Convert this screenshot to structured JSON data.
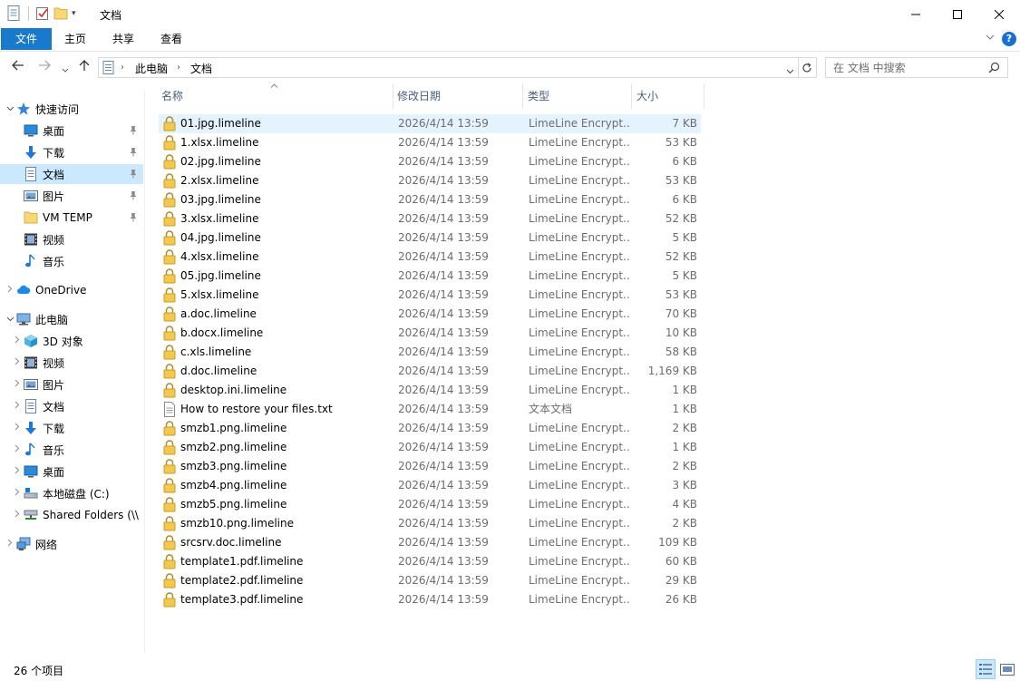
{
  "window": {
    "title": "文档"
  },
  "ribbon": {
    "tabs": [
      "文件",
      "主页",
      "共享",
      "查看"
    ],
    "help": "?"
  },
  "address": {
    "crumbs": [
      "此电脑",
      "文档"
    ],
    "search_placeholder": "在 文档 中搜索"
  },
  "nav": {
    "items": [
      {
        "label": "快速访问",
        "icon": "star-icon",
        "chev": "v",
        "indent": 0,
        "pinned": false,
        "selected": false
      },
      {
        "label": "桌面",
        "icon": "desktop-icon",
        "chev": "",
        "indent": 1,
        "pinned": true,
        "selected": false
      },
      {
        "label": "下载",
        "icon": "download-icon",
        "chev": "",
        "indent": 1,
        "pinned": true,
        "selected": false
      },
      {
        "label": "文档",
        "icon": "document-icon",
        "chev": "",
        "indent": 1,
        "pinned": true,
        "selected": true
      },
      {
        "label": "图片",
        "icon": "picture-icon",
        "chev": "",
        "indent": 1,
        "pinned": true,
        "selected": false
      },
      {
        "label": "VM TEMP",
        "icon": "folder-icon",
        "chev": "",
        "indent": 1,
        "pinned": true,
        "selected": false
      },
      {
        "label": "视频",
        "icon": "video-icon",
        "chev": "",
        "indent": 1,
        "pinned": false,
        "selected": false
      },
      {
        "label": "音乐",
        "icon": "music-icon",
        "chev": "",
        "indent": 1,
        "pinned": false,
        "selected": false
      },
      {
        "label": "OneDrive",
        "icon": "cloud-icon",
        "chev": ">",
        "indent": 0,
        "pinned": false,
        "selected": false
      },
      {
        "label": "此电脑",
        "icon": "computer-icon",
        "chev": "v",
        "indent": 0,
        "pinned": false,
        "selected": false
      },
      {
        "label": "3D 对象",
        "icon": "cube-icon",
        "chev": ">",
        "indent": 1,
        "pinned": false,
        "selected": false
      },
      {
        "label": "视频",
        "icon": "video-icon",
        "chev": ">",
        "indent": 1,
        "pinned": false,
        "selected": false
      },
      {
        "label": "图片",
        "icon": "picture-icon",
        "chev": ">",
        "indent": 1,
        "pinned": false,
        "selected": false
      },
      {
        "label": "文档",
        "icon": "document-icon",
        "chev": ">",
        "indent": 1,
        "pinned": false,
        "selected": false
      },
      {
        "label": "下载",
        "icon": "download-icon",
        "chev": ">",
        "indent": 1,
        "pinned": false,
        "selected": false
      },
      {
        "label": "音乐",
        "icon": "music-icon",
        "chev": ">",
        "indent": 1,
        "pinned": false,
        "selected": false
      },
      {
        "label": "桌面",
        "icon": "desktop-icon",
        "chev": ">",
        "indent": 1,
        "pinned": false,
        "selected": false
      },
      {
        "label": "本地磁盘 (C:)",
        "icon": "drive-icon",
        "chev": ">",
        "indent": 1,
        "pinned": false,
        "selected": false
      },
      {
        "label": "Shared Folders (\\\\",
        "icon": "network-drive-icon",
        "chev": ">",
        "indent": 1,
        "pinned": false,
        "selected": false
      },
      {
        "label": "网络",
        "icon": "network-icon",
        "chev": ">",
        "indent": 0,
        "pinned": false,
        "selected": false
      }
    ]
  },
  "columns": {
    "name": "名称",
    "date": "修改日期",
    "type": "类型",
    "size": "大小"
  },
  "files": [
    {
      "name": "01.jpg.limeline",
      "date": "2026/4/14 13:59",
      "type": "LimeLine Encrypt...",
      "size": "7 KB",
      "icon": "lock-icon",
      "selected": true
    },
    {
      "name": "1.xlsx.limeline",
      "date": "2026/4/14 13:59",
      "type": "LimeLine Encrypt...",
      "size": "53 KB",
      "icon": "lock-icon"
    },
    {
      "name": "02.jpg.limeline",
      "date": "2026/4/14 13:59",
      "type": "LimeLine Encrypt...",
      "size": "6 KB",
      "icon": "lock-icon"
    },
    {
      "name": "2.xlsx.limeline",
      "date": "2026/4/14 13:59",
      "type": "LimeLine Encrypt...",
      "size": "53 KB",
      "icon": "lock-icon"
    },
    {
      "name": "03.jpg.limeline",
      "date": "2026/4/14 13:59",
      "type": "LimeLine Encrypt...",
      "size": "6 KB",
      "icon": "lock-icon"
    },
    {
      "name": "3.xlsx.limeline",
      "date": "2026/4/14 13:59",
      "type": "LimeLine Encrypt...",
      "size": "52 KB",
      "icon": "lock-icon"
    },
    {
      "name": "04.jpg.limeline",
      "date": "2026/4/14 13:59",
      "type": "LimeLine Encrypt...",
      "size": "5 KB",
      "icon": "lock-icon"
    },
    {
      "name": "4.xlsx.limeline",
      "date": "2026/4/14 13:59",
      "type": "LimeLine Encrypt...",
      "size": "52 KB",
      "icon": "lock-icon"
    },
    {
      "name": "05.jpg.limeline",
      "date": "2026/4/14 13:59",
      "type": "LimeLine Encrypt...",
      "size": "5 KB",
      "icon": "lock-icon"
    },
    {
      "name": "5.xlsx.limeline",
      "date": "2026/4/14 13:59",
      "type": "LimeLine Encrypt...",
      "size": "53 KB",
      "icon": "lock-icon"
    },
    {
      "name": "a.doc.limeline",
      "date": "2026/4/14 13:59",
      "type": "LimeLine Encrypt...",
      "size": "70 KB",
      "icon": "lock-icon"
    },
    {
      "name": "b.docx.limeline",
      "date": "2026/4/14 13:59",
      "type": "LimeLine Encrypt...",
      "size": "10 KB",
      "icon": "lock-icon"
    },
    {
      "name": "c.xls.limeline",
      "date": "2026/4/14 13:59",
      "type": "LimeLine Encrypt...",
      "size": "58 KB",
      "icon": "lock-icon"
    },
    {
      "name": "d.doc.limeline",
      "date": "2026/4/14 13:59",
      "type": "LimeLine Encrypt...",
      "size": "1,169 KB",
      "icon": "lock-icon"
    },
    {
      "name": "desktop.ini.limeline",
      "date": "2026/4/14 13:59",
      "type": "LimeLine Encrypt...",
      "size": "1 KB",
      "icon": "lock-icon"
    },
    {
      "name": "How to restore your files.txt",
      "date": "2026/4/14 13:59",
      "type": "文本文档",
      "size": "1 KB",
      "icon": "text-file-icon"
    },
    {
      "name": "smzb1.png.limeline",
      "date": "2026/4/14 13:59",
      "type": "LimeLine Encrypt...",
      "size": "2 KB",
      "icon": "lock-icon"
    },
    {
      "name": "smzb2.png.limeline",
      "date": "2026/4/14 13:59",
      "type": "LimeLine Encrypt...",
      "size": "1 KB",
      "icon": "lock-icon"
    },
    {
      "name": "smzb3.png.limeline",
      "date": "2026/4/14 13:59",
      "type": "LimeLine Encrypt...",
      "size": "2 KB",
      "icon": "lock-icon"
    },
    {
      "name": "smzb4.png.limeline",
      "date": "2026/4/14 13:59",
      "type": "LimeLine Encrypt...",
      "size": "3 KB",
      "icon": "lock-icon"
    },
    {
      "name": "smzb5.png.limeline",
      "date": "2026/4/14 13:59",
      "type": "LimeLine Encrypt...",
      "size": "4 KB",
      "icon": "lock-icon"
    },
    {
      "name": "smzb10.png.limeline",
      "date": "2026/4/14 13:59",
      "type": "LimeLine Encrypt...",
      "size": "2 KB",
      "icon": "lock-icon"
    },
    {
      "name": "srcsrv.doc.limeline",
      "date": "2026/4/14 13:59",
      "type": "LimeLine Encrypt...",
      "size": "109 KB",
      "icon": "lock-icon"
    },
    {
      "name": "template1.pdf.limeline",
      "date": "2026/4/14 13:59",
      "type": "LimeLine Encrypt...",
      "size": "60 KB",
      "icon": "lock-icon"
    },
    {
      "name": "template2.pdf.limeline",
      "date": "2026/4/14 13:59",
      "type": "LimeLine Encrypt...",
      "size": "29 KB",
      "icon": "lock-icon"
    },
    {
      "name": "template3.pdf.limeline",
      "date": "2026/4/14 13:59",
      "type": "LimeLine Encrypt...",
      "size": "26 KB",
      "icon": "lock-icon"
    }
  ],
  "status": {
    "count": "26 个项目"
  },
  "colors": {
    "accent": "#1979ca",
    "selection": "#cce8ff",
    "hover_row": "#e5f3ff",
    "folder": "#f8d775",
    "lock": "#f0c040",
    "header_text": "#4c607a"
  }
}
